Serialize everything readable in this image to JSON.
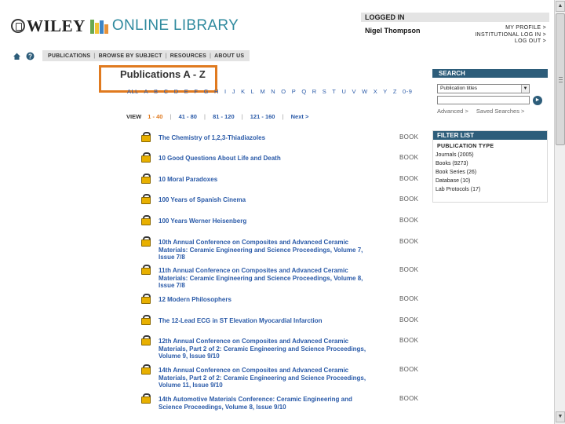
{
  "header": {
    "logo_text": "WILEY",
    "logo_online": "ONLINE LIBRARY",
    "logged_in_label": "LOGGED IN",
    "user_name": "Nigel Thompson",
    "account_links": [
      "MY PROFILE >",
      "INSTITUTIONAL LOG IN >",
      "LOG OUT >"
    ]
  },
  "nav": {
    "items": [
      "PUBLICATIONS",
      "BROWSE BY SUBJECT",
      "RESOURCES",
      "ABOUT US"
    ]
  },
  "main": {
    "title": "Publications A - Z",
    "letters": [
      "ALL",
      "A",
      "B",
      "C",
      "D",
      "E",
      "F",
      "G",
      "H",
      "I",
      "J",
      "K",
      "L",
      "M",
      "N",
      "O",
      "P",
      "Q",
      "R",
      "S",
      "T",
      "U",
      "V",
      "W",
      "X",
      "Y",
      "Z",
      "0-9"
    ],
    "view_label": "VIEW",
    "pages": [
      "1 - 40",
      "41 - 80",
      "81 - 120",
      "121 - 160",
      "Next >"
    ],
    "publications": [
      {
        "title": "The Chemistry of 1,2,3-Thiadiazoles",
        "type": "BOOK"
      },
      {
        "title": "10 Good Questions About Life and Death",
        "type": "BOOK"
      },
      {
        "title": "10 Moral Paradoxes",
        "type": "BOOK"
      },
      {
        "title": "100 Years of Spanish Cinema",
        "type": "BOOK"
      },
      {
        "title": "100 Years Werner Heisenberg",
        "type": "BOOK"
      },
      {
        "title": "10th Annual Conference on Composites and Advanced Ceramic Materials: Ceramic Engineering and Science Proceedings, Volume 7, Issue 7/8",
        "type": "BOOK"
      },
      {
        "title": "11th Annual Conference on Composites and Advanced Ceramic Materials: Ceramic Engineering and Science Proceedings, Volume 8, Issue 7/8",
        "type": "BOOK"
      },
      {
        "title": "12 Modern Philosophers",
        "type": "BOOK"
      },
      {
        "title": "The 12-Lead ECG in ST Elevation Myocardial Infarction",
        "type": "BOOK"
      },
      {
        "title": "12th Annual Conference on Composites and Advanced Ceramic Materials, Part 2 of 2: Ceramic Engineering and Science Proceedings, Volume 9, Issue 9/10",
        "type": "BOOK"
      },
      {
        "title": "14th Annual Conference on Composites and Advanced Ceramic Materials, Part 2 of 2: Ceramic Engineering and Science Proceedings, Volume 11, Issue 9/10",
        "type": "BOOK"
      },
      {
        "title": "14th Automotive Materials Conference: Ceramic Engineering and Science Proceedings, Volume 8, Issue 9/10",
        "type": "BOOK"
      }
    ]
  },
  "search": {
    "heading": "SEARCH",
    "scope_value": "Publication titles",
    "query_value": "",
    "advanced_link": "Advanced >",
    "saved_link": "Saved Searches >"
  },
  "filter": {
    "heading": "FILTER LIST",
    "subheading": "PUBLICATION TYPE",
    "items": [
      "Journals (2005)",
      "Books (9273)",
      "Book Series (26)",
      "Database (10)",
      "Lab Protocols (17)"
    ]
  },
  "colors": {
    "link_blue": "#2a5aa8",
    "accent_orange": "#e07a1f",
    "panel_header": "#2d5d7a",
    "brand_teal": "#2f8a9e"
  },
  "icons": [
    "home-icon",
    "help-icon",
    "lock-icon",
    "go-arrow-icon"
  ]
}
